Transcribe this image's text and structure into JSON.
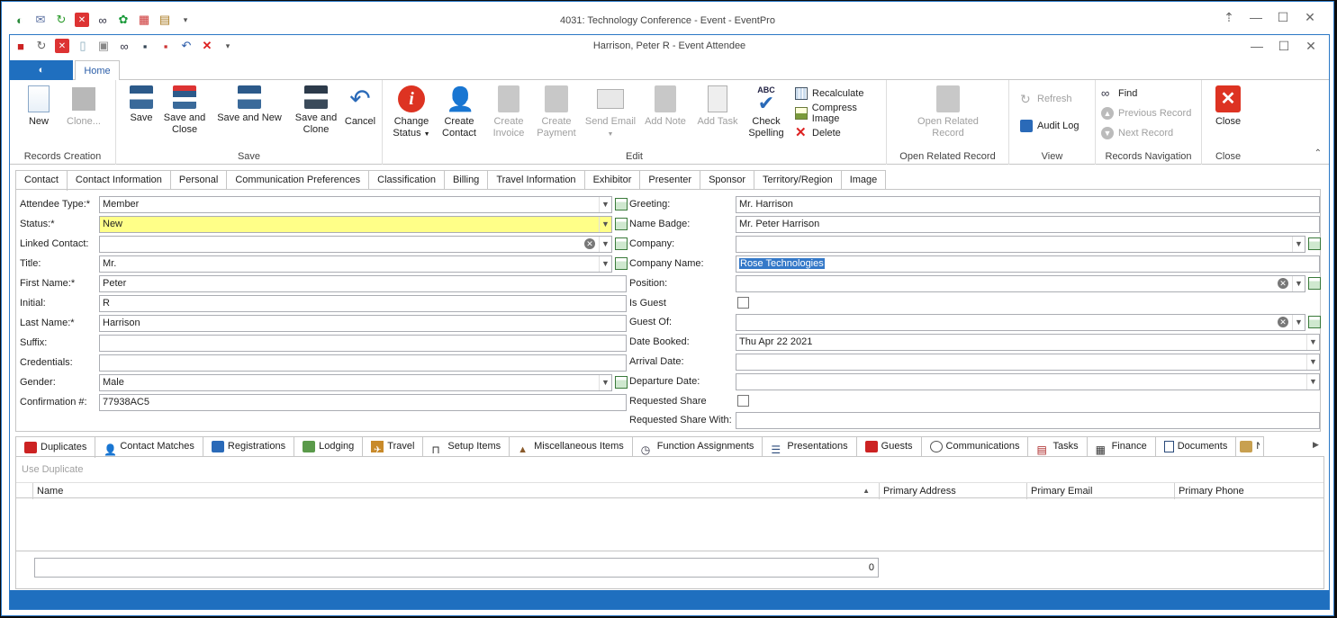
{
  "outer_window": {
    "title": "4031: Technology Conference - Event - EventPro",
    "controls": [
      "pin-icon",
      "minimize-icon",
      "maximize-icon",
      "close-icon"
    ]
  },
  "inner_window": {
    "title": "Harrison, Peter R - Event Attendee"
  },
  "ribbon_tabs": {
    "home": "Home"
  },
  "ribbon": {
    "records_creation": {
      "label": "Records Creation",
      "new": "New",
      "clone": "Clone..."
    },
    "save": {
      "label": "Save",
      "save": "Save",
      "save_close_1": "Save and",
      "save_close_2": "Close",
      "save_new": "Save and New",
      "save_clone_1": "Save and",
      "save_clone_2": "Clone",
      "cancel": "Cancel"
    },
    "edit": {
      "label": "Edit",
      "change_status_1": "Change",
      "change_status_2": "Status",
      "create_contact_1": "Create",
      "create_contact_2": "Contact",
      "create_invoice_1": "Create",
      "create_invoice_2": "Invoice",
      "create_payment_1": "Create",
      "create_payment_2": "Payment",
      "send_email": "Send Email",
      "add_note": "Add Note",
      "add_task": "Add Task",
      "check_spelling_1": "Check",
      "check_spelling_2": "Spelling",
      "recalculate": "Recalculate",
      "compress_image": "Compress Image",
      "delete": "Delete"
    },
    "open_related": {
      "label": "Open Related Record",
      "btn_1": "Open Related",
      "btn_2": "Record"
    },
    "view": {
      "label": "View",
      "refresh": "Refresh",
      "audit_log": "Audit Log"
    },
    "navigation": {
      "label": "Records Navigation",
      "find": "Find",
      "previous": "Previous Record",
      "next": "Next Record"
    },
    "close": {
      "label": "Close",
      "close": "Close"
    }
  },
  "form_tabs": [
    "Contact",
    "Contact Information",
    "Personal",
    "Communication Preferences",
    "Classification",
    "Billing",
    "Travel Information",
    "Exhibitor",
    "Presenter",
    "Sponsor",
    "Territory/Region",
    "Image"
  ],
  "form": {
    "attendee_type": {
      "label": "Attendee Type:*",
      "value": "Member"
    },
    "status": {
      "label": "Status:*",
      "value": "New"
    },
    "linked_contact": {
      "label": "Linked Contact:",
      "value": ""
    },
    "title": {
      "label": "Title:",
      "value": "Mr."
    },
    "first_name": {
      "label": "First Name:*",
      "value": "Peter"
    },
    "initial": {
      "label": "Initial:",
      "value": "R"
    },
    "last_name": {
      "label": "Last Name:*",
      "value": "Harrison"
    },
    "suffix": {
      "label": "Suffix:",
      "value": ""
    },
    "credentials": {
      "label": "Credentials:",
      "value": ""
    },
    "gender": {
      "label": "Gender:",
      "value": "Male"
    },
    "confirmation": {
      "label": "Confirmation #:",
      "value": "77938AC5"
    },
    "greeting": {
      "label": "Greeting:",
      "value": "Mr. Harrison"
    },
    "name_badge": {
      "label": "Name Badge:",
      "value": "Mr. Peter Harrison"
    },
    "company": {
      "label": "Company:",
      "value": ""
    },
    "company_name": {
      "label": "Company Name:",
      "value": "Rose Technologies"
    },
    "position": {
      "label": "Position:",
      "value": ""
    },
    "is_guest": {
      "label": "Is Guest"
    },
    "guest_of": {
      "label": "Guest Of:",
      "value": ""
    },
    "date_booked": {
      "label": "Date Booked:",
      "value": "Thu Apr 22 2021"
    },
    "arrival_date": {
      "label": "Arrival Date:",
      "value": ""
    },
    "departure_date": {
      "label": "Departure Date:",
      "value": ""
    },
    "requested_share": {
      "label": "Requested Share"
    },
    "requested_share_with": {
      "label": "Requested Share With:",
      "value": ""
    }
  },
  "bottom_tabs": [
    "Duplicates",
    "Contact Matches",
    "Registrations",
    "Lodging",
    "Travel",
    "Setup Items",
    "Miscellaneous Items",
    "Function Assignments",
    "Presentations",
    "Guests",
    "Communications",
    "Tasks",
    "Finance",
    "Documents"
  ],
  "duplicates": {
    "use_duplicate": "Use Duplicate",
    "columns": {
      "name": "Name",
      "primary_address": "Primary Address",
      "primary_email": "Primary Email",
      "primary_phone": "Primary Phone"
    },
    "count": "0"
  },
  "colors": {
    "accent": "#1f6fbf",
    "required_highlight": "#ffff88",
    "selection": "#3478c8"
  }
}
